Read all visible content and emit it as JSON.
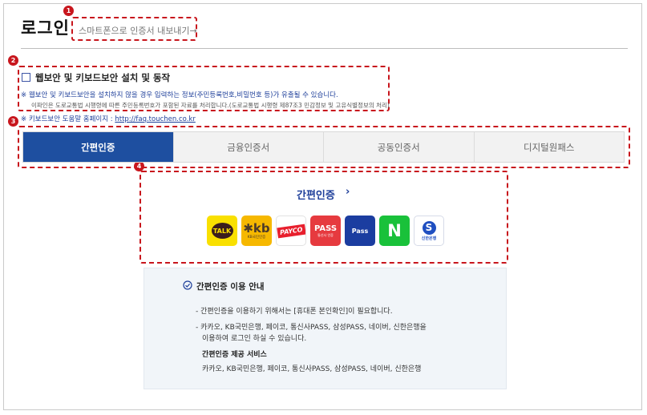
{
  "header": {
    "title": "로그인",
    "export_link": "스마트폰으로 인증서 내보내기→"
  },
  "markers": [
    "1",
    "2",
    "3",
    "4"
  ],
  "security": {
    "checkbox_label": "웹보안 및 키보드보안 설치 및 동작",
    "checkbox_checked": false,
    "warning": "※ 웹보안 및 키보드보안을 설치하지 않을 경우 입력하는 정보(주민등록번호,비밀번호 등)가 유출될 수 있습니다.",
    "notice": "이파인은 도로교통법 시행령에 따른 주민등록번호가 포함된 자료를 처리합니다.(도로교통법 시행령 제87조3 민감정보 및 고유식별정보의 처리)",
    "help_prefix": "※ 키보드보안 도움말 홈페이지 : ",
    "help_url": "http://faq.touchen.co.kr"
  },
  "tabs": [
    {
      "label": "간편인증",
      "active": true
    },
    {
      "label": "금융인증서",
      "active": false
    },
    {
      "label": "공동인증서",
      "active": false
    },
    {
      "label": "디지털원패스",
      "active": false
    }
  ],
  "simple_auth": {
    "title": "간편인증",
    "chevron": "›",
    "providers": [
      {
        "id": "kakao",
        "text": "TALK",
        "color": "#f9e000"
      },
      {
        "id": "kb",
        "text": "kb",
        "sub": "KB국민인증",
        "color": "#f6b800"
      },
      {
        "id": "payco",
        "text": "PAYCO",
        "color": "#e81f2d"
      },
      {
        "id": "pass",
        "text": "PASS",
        "sub": "통신사 인증",
        "color": "#e63a3f"
      },
      {
        "id": "samsung-pass",
        "text": "Pass",
        "color": "#1b3da0"
      },
      {
        "id": "naver",
        "text": "N",
        "color": "#19c13a"
      },
      {
        "id": "shinhan",
        "text": "S",
        "sub": "신한은행",
        "color": "#1f4fc1"
      }
    ]
  },
  "guide": {
    "title": "간편인증 이용 안내",
    "line1": "- 간편인증을 이용하기 위해서는 [휴대폰 본인확인]이 필요합니다.",
    "line2a": "- 카카오, KB국민은행, 페이코, 통신사PASS, 삼성PASS, 네이버, 신한은행을",
    "line2b": "이용하여 로그인 하실 수 있습니다.",
    "subtitle": "간편인증 제공 서비스",
    "services": "카카오, KB국민은행, 페이코, 통신사PASS, 삼성PASS, 네이버, 신한은행"
  },
  "colors": {
    "accent": "#1e4fa0",
    "annotation": "#c8161d",
    "link": "#1e3f9a"
  }
}
